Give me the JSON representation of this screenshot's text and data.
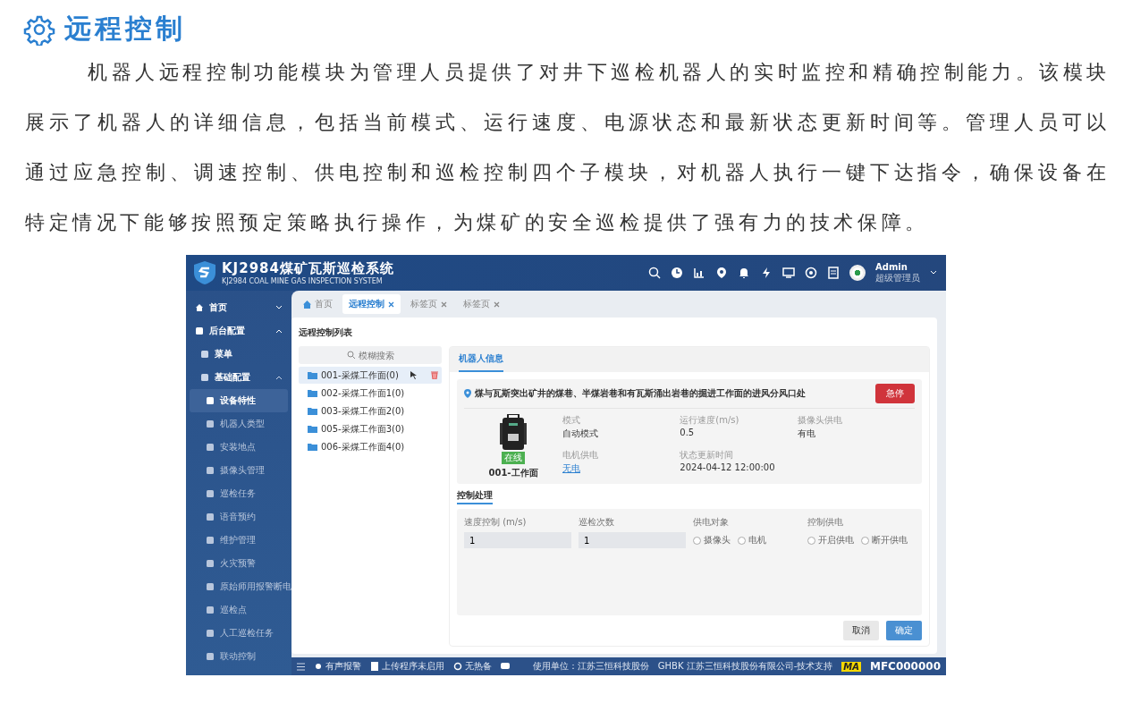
{
  "heading": "远程控制",
  "paragraph": "机器人远程控制功能模块为管理人员提供了对井下巡检机器人的实时监控和精确控制能力。该模块展示了机器人的详细信息，包括当前模式、运行速度、电源状态和最新状态更新时间等。管理人员可以通过应急控制、调速控制、供电控制和巡检控制四个子模块，对机器人执行一键下达指令，确保设备在特定情况下能够按照预定策略执行操作，为煤矿的安全巡检提供了强有力的技术保障。",
  "app": {
    "title": "KJ2984煤矿瓦斯巡检系统",
    "subtitle": "KJ2984 COAL MINE GAS INSPECTION SYSTEM",
    "user": {
      "name": "Admin",
      "role": "超级管理员"
    },
    "sidebar": [
      {
        "label": "首页",
        "expanded": false,
        "selected": false
      },
      {
        "label": "后台配置",
        "expanded": true,
        "selected": false,
        "children": [
          {
            "label": "菜单",
            "selected": false
          },
          {
            "label": "基础配置",
            "expanded": true,
            "selected": false,
            "children": [
              {
                "label": "设备特性",
                "selected": true
              },
              {
                "label": "机器人类型",
                "selected": false
              },
              {
                "label": "安装地点",
                "selected": false
              },
              {
                "label": "摄像头管理",
                "selected": false
              },
              {
                "label": "巡检任务",
                "selected": false
              },
              {
                "label": "语音预约",
                "selected": false
              },
              {
                "label": "维护管理",
                "selected": false
              },
              {
                "label": "火灾预警",
                "selected": false
              },
              {
                "label": "原始师用报警断电",
                "selected": false
              },
              {
                "label": "巡检点",
                "selected": false
              },
              {
                "label": "人工巡检任务",
                "selected": false
              },
              {
                "label": "联动控制",
                "selected": false
              }
            ]
          }
        ]
      }
    ],
    "tabs": [
      {
        "label": "首页",
        "selected": false,
        "closable": false
      },
      {
        "label": "远程控制",
        "selected": true,
        "closable": true
      },
      {
        "label": "标签页",
        "selected": false,
        "closable": true
      },
      {
        "label": "标签页",
        "selected": false,
        "closable": true
      }
    ],
    "list_title": "远程控制列表",
    "search": {
      "placeholder": "模糊搜索"
    },
    "tree": [
      {
        "label": "001-采煤工作面(0)",
        "selected": true
      },
      {
        "label": "002-采煤工作面1(0)",
        "selected": false
      },
      {
        "label": "003-采煤工作面2(0)",
        "selected": false
      },
      {
        "label": "005-采煤工作面3(0)",
        "selected": false
      },
      {
        "label": "006-采煤工作面4(0)",
        "selected": false
      }
    ],
    "panel_tab": "机器人信息",
    "location": "煤与瓦斯突出矿井的煤巷、半煤岩巷和有瓦斯涌出岩巷的掘进工作面的进风分风口处",
    "stop_button": "急停",
    "robot": {
      "badge": "在线",
      "name": "001-工作面"
    },
    "info": [
      {
        "label": "模式",
        "value": "自动模式",
        "kind": "text"
      },
      {
        "label": "运行速度(m/s)",
        "value": "0.5",
        "kind": "text"
      },
      {
        "label": "摄像头供电",
        "value": "有电",
        "kind": "text"
      },
      {
        "label": "电机供电",
        "value": "无电",
        "kind": "link"
      },
      {
        "label": "状态更新时间",
        "value": "2024-04-12 12:00:00",
        "kind": "text"
      }
    ],
    "control_title": "控制处理",
    "controls": [
      {
        "label": "速度控制 (m/s)",
        "kind": "input",
        "value": "1"
      },
      {
        "label": "巡检次数",
        "kind": "input",
        "value": "1"
      },
      {
        "label": "供电对象",
        "kind": "radio",
        "options": [
          {
            "label": "摄像头",
            "selected": false
          },
          {
            "label": "电机",
            "selected": false
          }
        ]
      },
      {
        "label": "控制供电",
        "kind": "radio",
        "options": [
          {
            "label": "开启供电",
            "selected": false
          },
          {
            "label": "断开供电",
            "selected": false
          }
        ]
      }
    ],
    "buttons": [
      {
        "label": "取消",
        "kind": "secondary"
      },
      {
        "label": "确定",
        "kind": "primary"
      }
    ],
    "footer": {
      "left": [
        "有声报警",
        "上传程序未启用",
        "无热备"
      ],
      "unit": "使用单位：江苏三恒科技股份",
      "support": "GHBK 江苏三恒科技股份有限公司-技术支持",
      "mark": "MA",
      "code": "MFC000000"
    }
  }
}
